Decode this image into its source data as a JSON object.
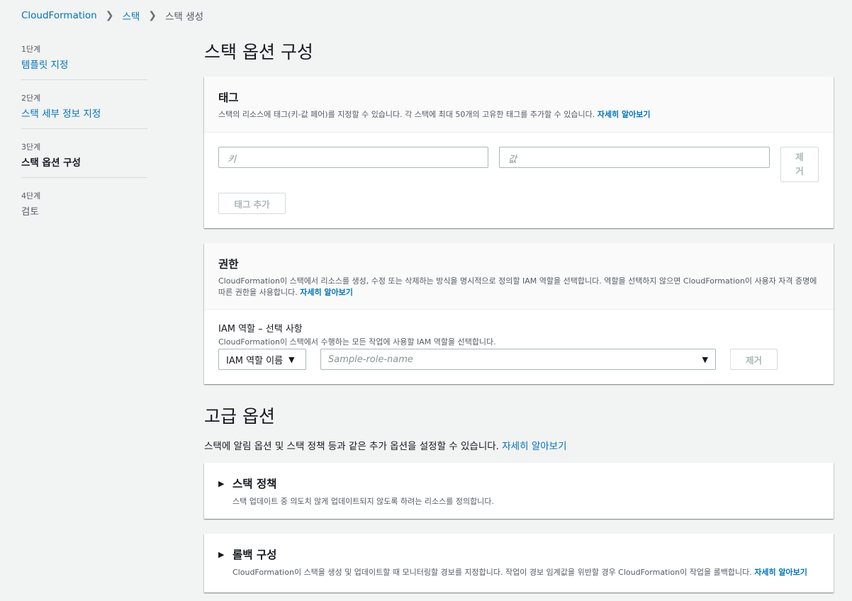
{
  "breadcrumb": {
    "items": [
      "CloudFormation",
      "스택"
    ],
    "current": "스택 생성"
  },
  "steps": [
    {
      "num": "1단계",
      "label": "템플릿 지정"
    },
    {
      "num": "2단계",
      "label": "스택 세부 정보 지정"
    },
    {
      "num": "3단계",
      "label": "스택 옵션 구성"
    },
    {
      "num": "4단계",
      "label": "검토"
    }
  ],
  "page_title": "스택 옵션 구성",
  "tags": {
    "title": "태그",
    "description": "스택의 리소스에 태그(키-값 페어)를 지정할 수 있습니다. 각 스택에 최대 50개의 고유한 태그를 추가할 수 있습니다.",
    "learn_more": "자세히 알아보기",
    "key_placeholder": "키",
    "value_placeholder": "값",
    "remove_label": "제거",
    "add_label": "태그 추가"
  },
  "permissions": {
    "title": "권한",
    "description": "CloudFormation이 스택에서 리소스를 생성, 수정 또는 삭제하는 방식을 명시적으로 정의할 IAM 역할을 선택합니다. 역할을 선택하지 않으면 CloudFormation이 사용자 자격 증명에 따른 권한을 사용합니다.",
    "learn_more": "자세히 알아보기",
    "field_label": "IAM 역할 – 선택 사항",
    "field_desc": "CloudFormation이 스택에서 수행하는 모든 작업에 사용할 IAM 역할을 선택합니다.",
    "type_select": "IAM 역할 이름",
    "role_placeholder": "Sample-role-name",
    "remove_label": "제거"
  },
  "advanced": {
    "title": "고급 옵션",
    "description": "스택에 알림 옵션 및 스택 정책 등과 같은 추가 옵션을 설정할 수 있습니다.",
    "learn_more": "자세히 알아보기",
    "sections": [
      {
        "title": "스택 정책",
        "desc": "스택 업데이트 중 의도치 않게 업데이트되지 않도록 하려는 리소스를 정의합니다."
      },
      {
        "title": "롤백 구성",
        "desc": "CloudFormation이 스택을 생성 및 업데이트할 때 모니터링할 경보를 지정합니다. 작업이 경보 임계값을 위반할 경우 CloudFormation이 작업을 롤백합니다.",
        "learn_more": "자세히 알아보기"
      }
    ]
  },
  "colors": {
    "link": "#0073bb",
    "background": "#f2f3f3"
  }
}
